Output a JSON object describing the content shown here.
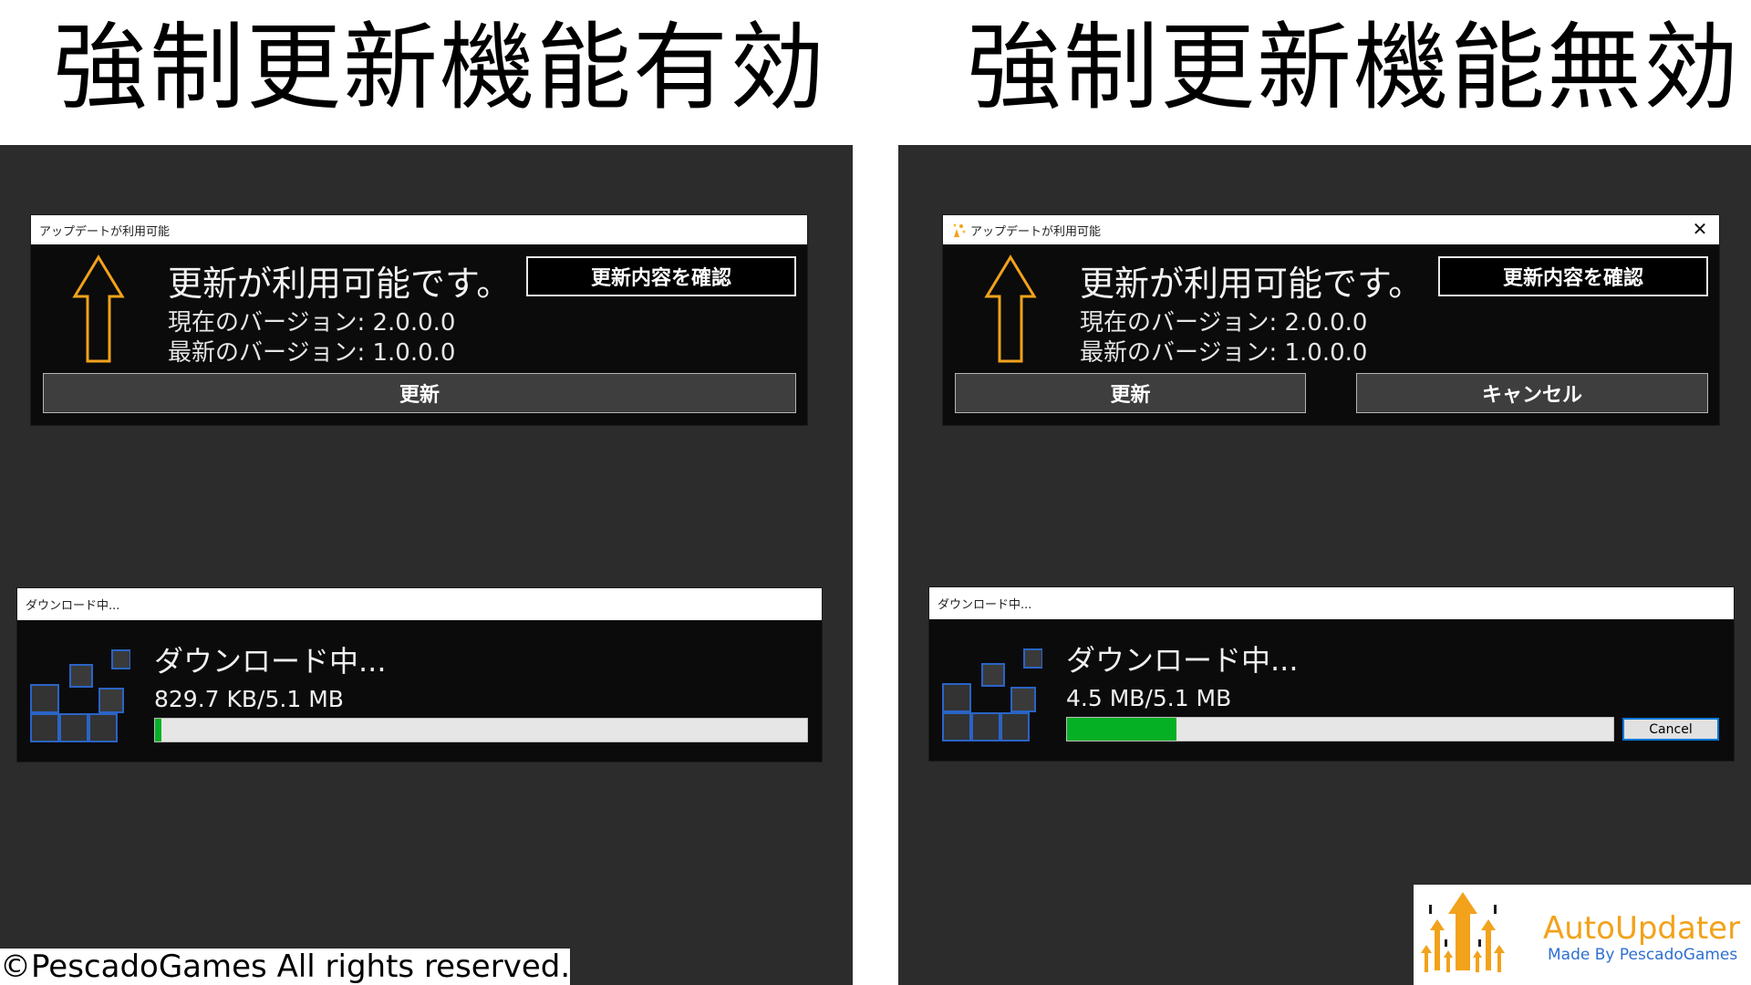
{
  "left": {
    "heading": "強制更新機能有効",
    "update_window": {
      "title": "アップデートが利用可能",
      "message": "更新が利用可能です。",
      "current_version": "現在のバージョン: 2.0.0.0",
      "latest_version": "最新のバージョン: 1.0.0.0",
      "details_button": "更新内容を確認",
      "update_button": "更新"
    },
    "download_window": {
      "title": "ダウンロード中...",
      "heading": "ダウンロード中...",
      "size": "829.7 KB/5.1 MB",
      "progress": 0.01
    }
  },
  "right": {
    "heading": "強制更新機能無効",
    "update_window": {
      "title": "アップデートが利用可能",
      "close_glyph": "✕",
      "message": "更新が利用可能です。",
      "current_version": "現在のバージョン: 2.0.0.0",
      "latest_version": "最新のバージョン: 1.0.0.0",
      "details_button": "更新内容を確認",
      "update_button": "更新",
      "cancel_button": "キャンセル"
    },
    "download_window": {
      "title": "ダウンロード中...",
      "heading": "ダウンロード中...",
      "size": "4.5 MB/5.1 MB",
      "progress": 0.2,
      "cancel_button": "Cancel"
    }
  },
  "footer": {
    "copyright": "©PescadoGames All rights reserved.",
    "logo_name": "AutoUpdater",
    "logo_by": "Made By PescadoGames"
  },
  "colors": {
    "panel_bg": "#2c2c2c",
    "window_bg": "#0b0b0b",
    "arrow_orange": "#f2a21b",
    "progress_green": "#06b025",
    "grid_blue": "#2a64c5",
    "logo_blue": "#2e6fd0"
  },
  "icons": {
    "update_arrow": "up-arrow-icon",
    "download_grid": "download-grid-icon",
    "title_app": "sparkle-app-icon",
    "logo": "autoupdater-logo-icon"
  }
}
